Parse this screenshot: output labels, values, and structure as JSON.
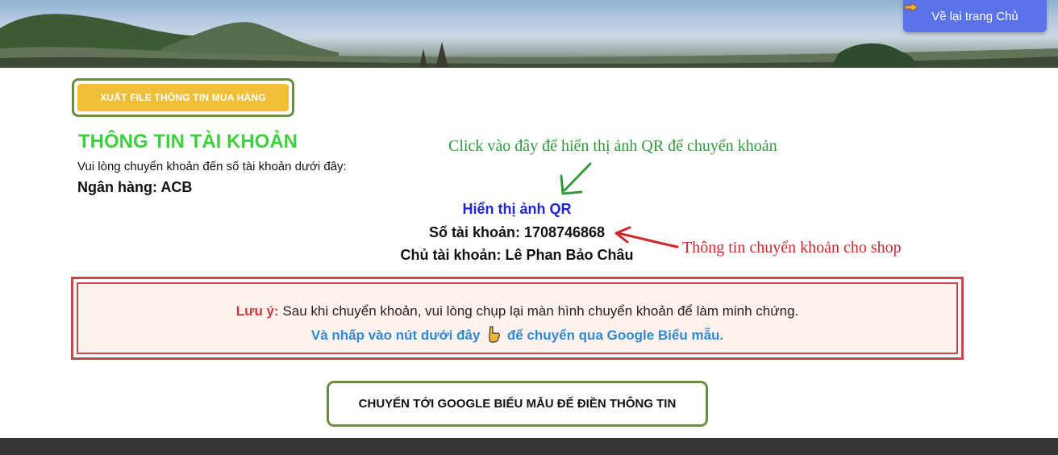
{
  "header": {
    "home_label": "Về lại trang Chủ",
    "home_icon": "pointing-hand-icon"
  },
  "export_button": {
    "label": "XUẤT FILE THÔNG TIN MUA HÀNG"
  },
  "account": {
    "title": "THÔNG TIN TÀI KHOẢN",
    "subtitle": "Vui lòng chuyển khoản đến số tài khoản dưới đây:",
    "bank": "Ngân hàng: ACB",
    "qr_link": "Hiển thị ảnh QR",
    "number": "Số tài khoản: 1708746868",
    "owner": "Chủ tài khoản: Lê Phan Bảo Châu"
  },
  "annotations": {
    "qr_hint": "Click vào đây để hiển thị ảnh QR để chuyển khoản",
    "shop_info_hint": "Thông tin chuyển khoản cho shop",
    "qr_hint_color": "#2f9a3a",
    "shop_info_color": "#d0262e"
  },
  "note": {
    "label": "Lưu ý:",
    "text": "Sau khi chuyển khoản, vui lòng chụp lại màn hình chuyển khoản để làm minh chứng.",
    "line2_before": "Và nhấp vào nút dưới đây",
    "line2_after": "để chuyển qua Google Biểu mẫu.",
    "icon": "pointing-down-hand-icon"
  },
  "form_button": {
    "label": "CHUYỂN TỚI GOOGLE BIỂU MẪU ĐỂ ĐIỀN THÔNG TIN"
  },
  "colors": {
    "title_green": "#3ecf3e",
    "link_blue": "#1f25d8",
    "note_red": "#c8474a",
    "note_blue": "#2f8ad0",
    "export_yellow": "#efbf3a",
    "home_button": "#5b73e8",
    "frame_green": "#6b8e3e"
  }
}
